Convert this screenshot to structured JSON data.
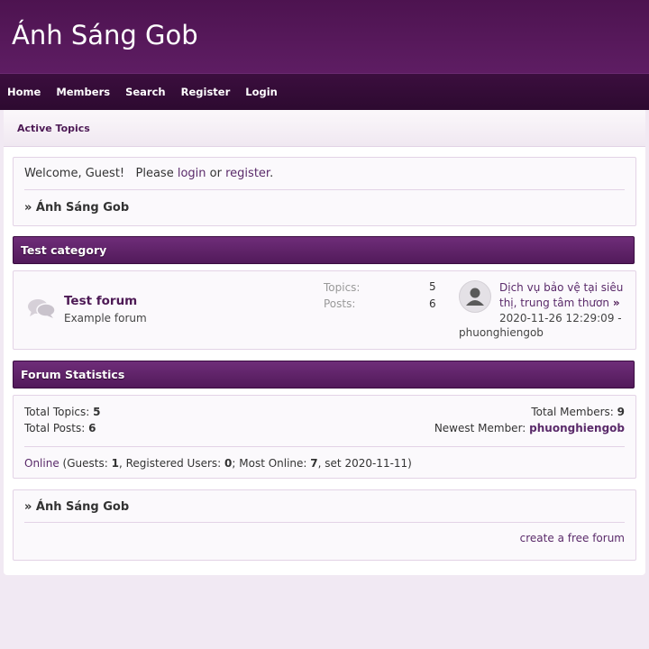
{
  "site": {
    "title": "Ánh Sáng Gob"
  },
  "nav": [
    "Home",
    "Members",
    "Search",
    "Register",
    "Login"
  ],
  "subnav": {
    "active_topics": "Active Topics"
  },
  "welcome": {
    "prefix": "Welcome, Guest!   Please",
    "login": "login",
    "or": "or",
    "register": "register",
    "period": ".",
    "breadcrumb": "» Ánh Sáng Gob"
  },
  "category": {
    "title": "Test category",
    "forum": {
      "name": "Test forum",
      "description": "Example forum",
      "topics_label": "Topics:",
      "topics": "5",
      "posts_label": "Posts:",
      "posts": "6",
      "last_post_title_1": "Dịch vụ bảo vệ tại siêu",
      "last_post_title_2": "thị, trung tâm thươn",
      "last_post_arrow": "»",
      "last_post_date": "2020-11-26 12:29:09 -",
      "last_post_user": "phuonghiengob"
    }
  },
  "stats": {
    "title": "Forum Statistics",
    "total_topics_label": "Total Topics:",
    "total_topics": "5",
    "total_posts_label": "Total Posts:",
    "total_posts": "6",
    "total_members_label": "Total Members:",
    "total_members": "9",
    "newest_member_label": "Newest Member:",
    "newest_member": "phuonghiengob",
    "online_link": "Online",
    "guests_label": "(Guests:",
    "guests": "1",
    "registered_label": ", Registered Users:",
    "registered": "0",
    "most_online_label": "; Most Online:",
    "most_online": "7",
    "most_online_date": ", set 2020-11-11)"
  },
  "footer": {
    "breadcrumb": "» Ánh Sáng Gob",
    "create_link": "create a free forum"
  },
  "colors": {
    "header": "#521a5a",
    "nav": "#2d0a30",
    "accent": "#5a2a6a"
  }
}
